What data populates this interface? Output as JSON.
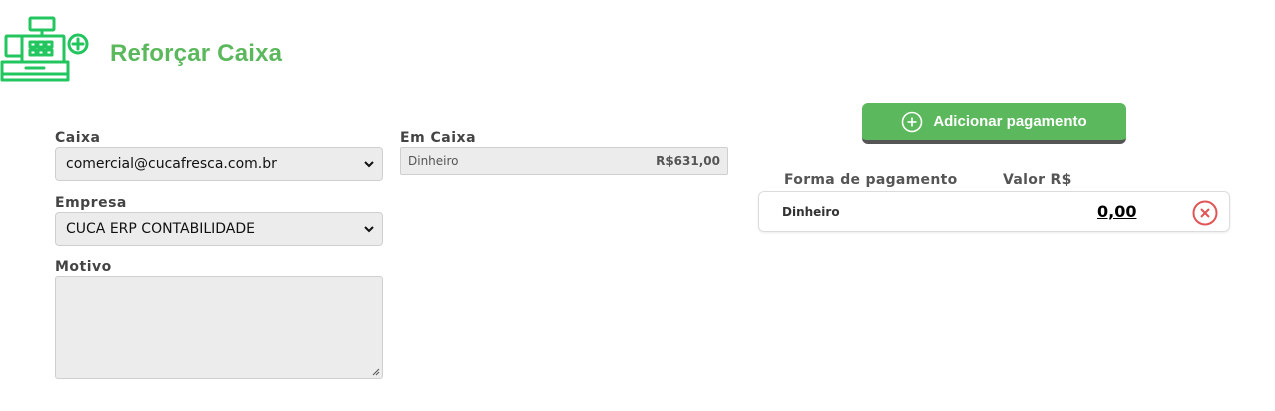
{
  "header": {
    "icon": "cash-register-plus-icon",
    "title": "Reforçar Caixa"
  },
  "form": {
    "caixa": {
      "label": "Caixa",
      "value": "comercial@cucafresca.com.br"
    },
    "empresa": {
      "label": "Empresa",
      "value": "CUCA ERP CONTABILIDADE"
    },
    "motivo": {
      "label": "Motivo",
      "value": ""
    }
  },
  "em_caixa": {
    "label": "Em Caixa",
    "method": "Dinheiro",
    "value": "R$631,00"
  },
  "actions": {
    "add_payment_label": "Adicionar pagamento"
  },
  "payments": {
    "headers": {
      "method": "Forma de pagamento",
      "value": "Valor R$"
    },
    "rows": [
      {
        "method": "Dinheiro",
        "value": "0,00"
      }
    ]
  },
  "colors": {
    "accent": "#5cb85c",
    "remove": "#e05555"
  }
}
